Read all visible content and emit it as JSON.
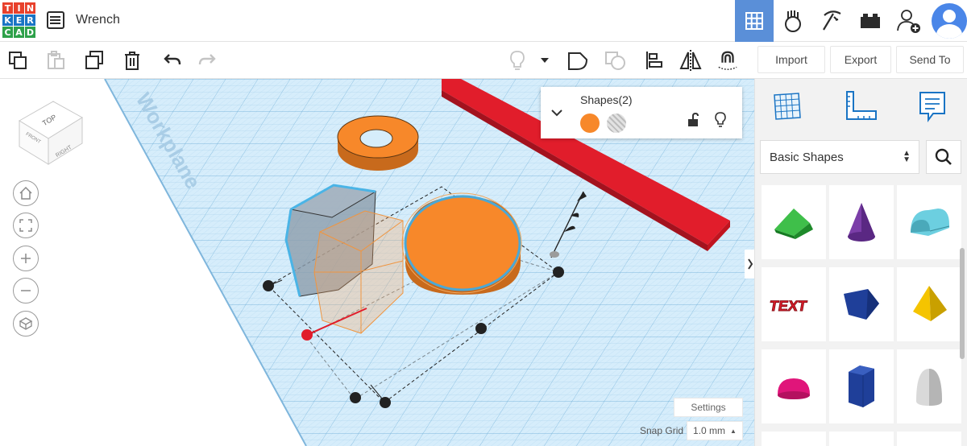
{
  "app": {
    "logo_letters": [
      "T",
      "I",
      "N",
      "K",
      "E",
      "R",
      "C",
      "A",
      "D"
    ],
    "logo_colors": [
      "#e8412c",
      "#e8412c",
      "#e8412c",
      "#1a74c4",
      "#1a74c4",
      "#1a74c4",
      "#2ea14a",
      "#2ea14a",
      "#2ea14a"
    ],
    "document_title": "Wrench"
  },
  "top_icons": [
    "grid-view-icon",
    "brick-hand-icon",
    "pickaxe-icon",
    "lego-brick-icon",
    "add-user-icon"
  ],
  "toolbar": {
    "import_label": "Import",
    "export_label": "Export",
    "send_to_label": "Send To"
  },
  "view_cube": {
    "top": "TOP",
    "front": "FRONT",
    "right": "RIGHT"
  },
  "workplane": {
    "label": "Workplane"
  },
  "shapes_panel": {
    "title": "Shapes(2)"
  },
  "viewport": {
    "settings_label": "Settings",
    "snap_grid_label": "Snap Grid",
    "snap_grid_value": "1.0 mm",
    "snap_arrow": "▲"
  },
  "library": {
    "category": "Basic Shapes",
    "shapes": [
      "box-wedge",
      "cone",
      "half-cylinder",
      "text",
      "polygon",
      "pyramid",
      "half-sphere",
      "hexagon",
      "paraboloid"
    ],
    "text_tile_label": "TEXT"
  },
  "colors": {
    "accent": "#5a8fd8",
    "orange": "#f7882a",
    "red_bar": "#e11d2b",
    "grid_bg": "#d4ecfa",
    "grid_line": "#9dc9e6"
  }
}
